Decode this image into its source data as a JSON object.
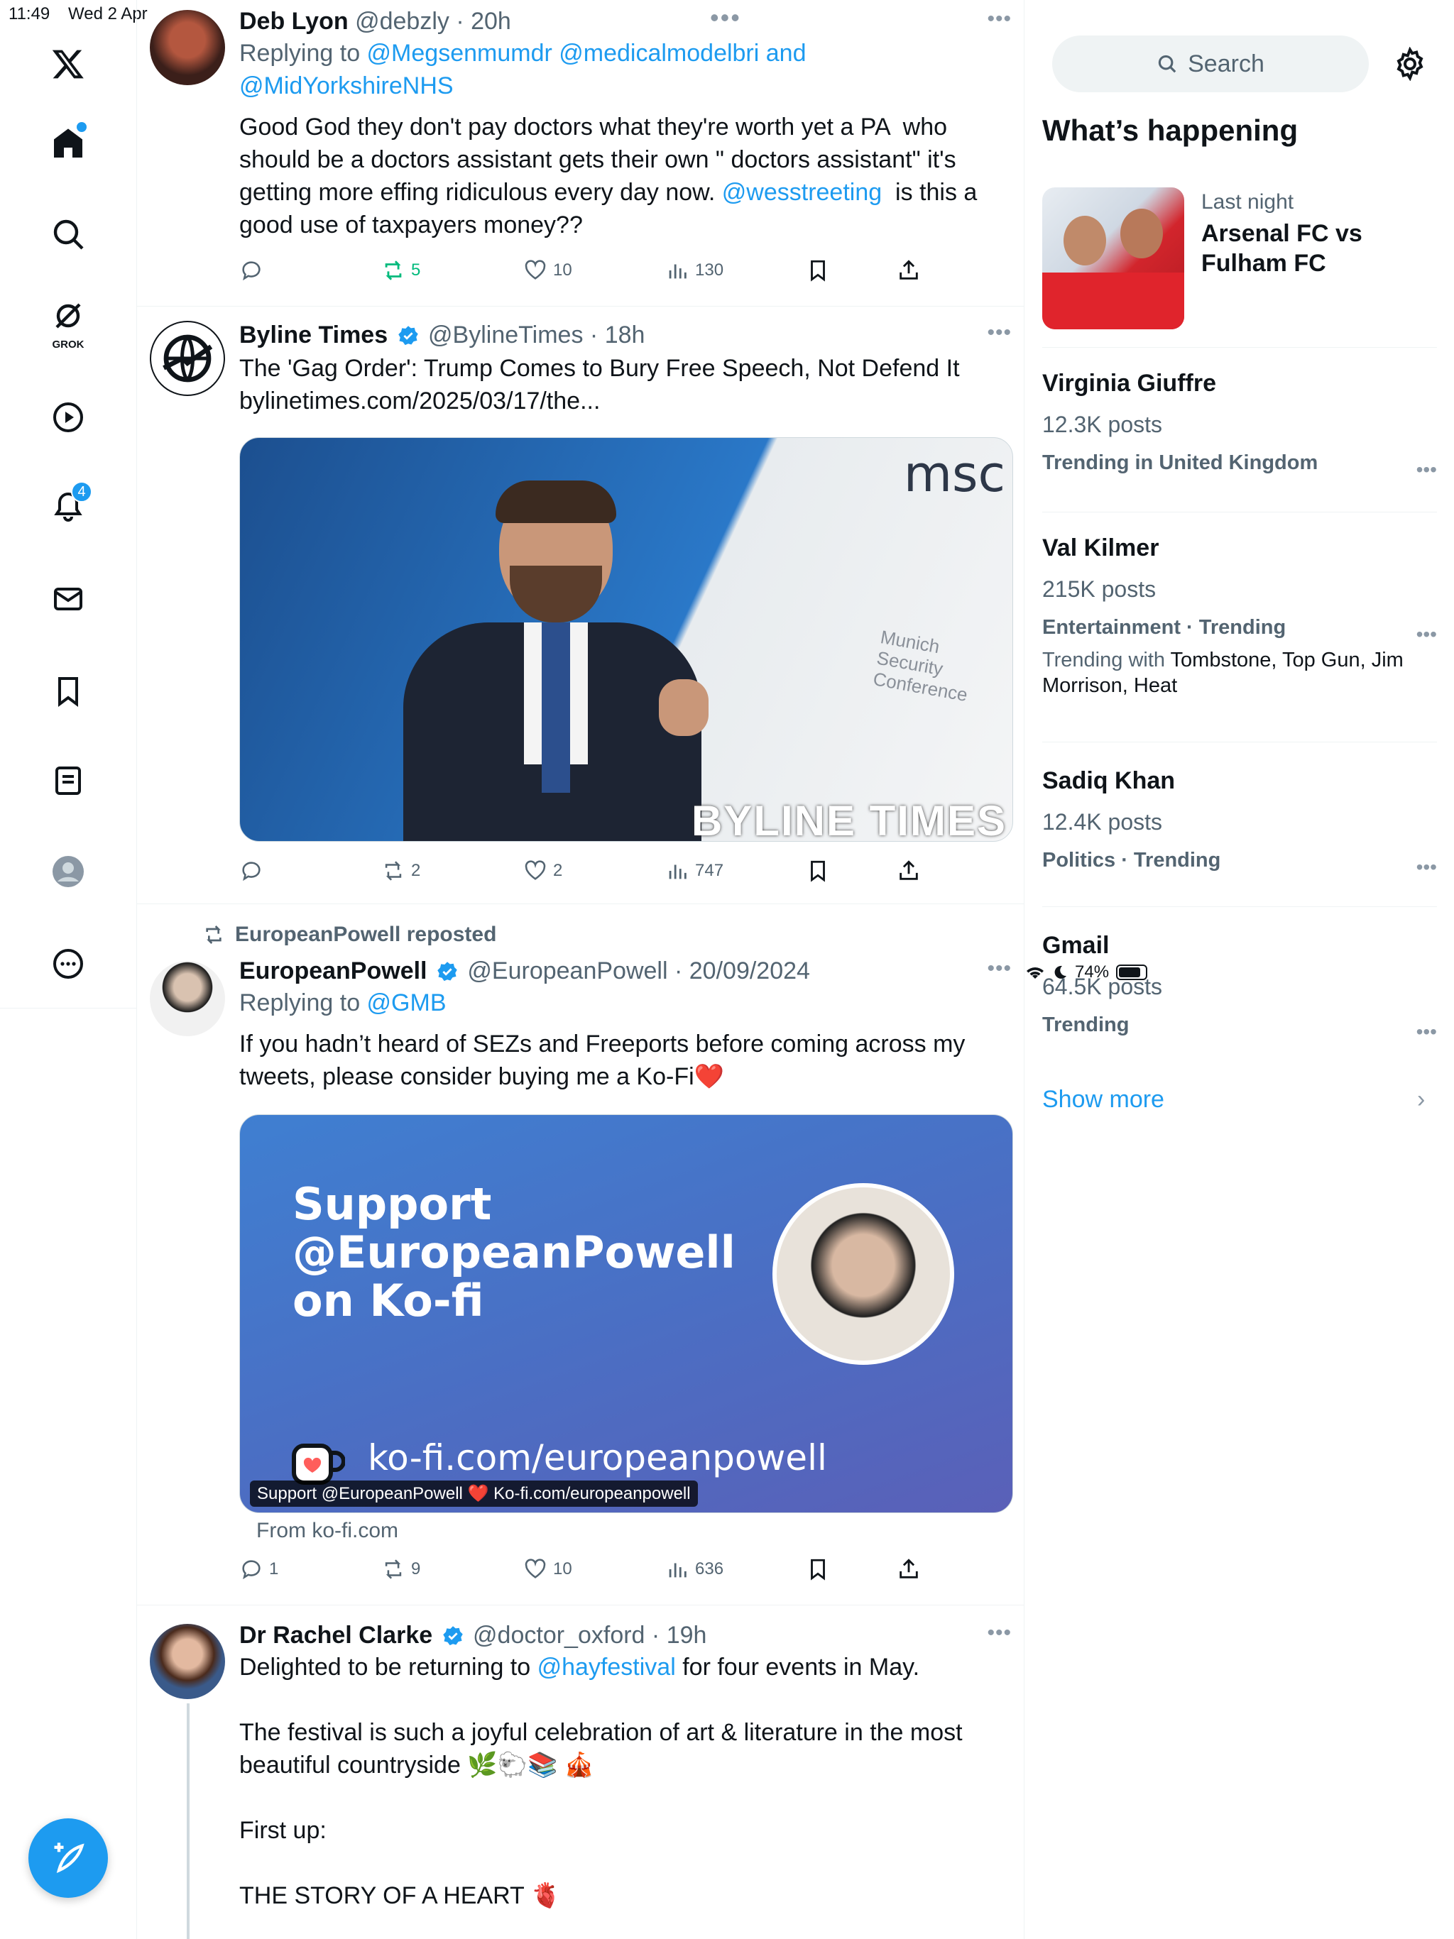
{
  "status_bar": {
    "time": "11:49",
    "date": "Wed 2 Apr",
    "battery": "74%"
  },
  "sidebar": {
    "items": [
      {
        "name": "x-logo"
      },
      {
        "name": "home"
      },
      {
        "name": "explore"
      },
      {
        "name": "grok",
        "label": "GROK"
      },
      {
        "name": "video"
      },
      {
        "name": "notifications",
        "badge": "4"
      },
      {
        "name": "messages"
      },
      {
        "name": "bookmarks"
      },
      {
        "name": "lists"
      },
      {
        "name": "profile"
      },
      {
        "name": "more"
      }
    ]
  },
  "tweets": [
    {
      "name": "Deb Lyon",
      "handle": "@debzly",
      "time": "20h",
      "replying_prefix": "Replying to ",
      "replying_to": "@Megsenmumdr @medicalmodelbri",
      "replying_and": " and",
      "replying_to_2": "@MidYorkshireNHS",
      "text_1": "Good God they don't pay doctors what they're worth yet a PA  who should be a doctors assistant gets their own \" doctors assistant\" it's getting more effing ridiculous every day now. ",
      "mention": "@wesstreeting",
      "text_2": "  is this a good use of taxpayers money??",
      "replies": "",
      "reposts": "5",
      "likes": "10",
      "views": "130"
    },
    {
      "name": "Byline Times",
      "handle": "@BylineTimes",
      "time": "18h",
      "text": "The 'Gag Order': Trump Comes to Bury Free Speech, Not Defend It",
      "link": "bylinetimes.com/2025/03/17/the...",
      "image_watermark": "BYLINE TIMES",
      "image_logo": "msc",
      "image_sign": "Munich Security Conference",
      "replies": "",
      "reposts": "2",
      "likes": "2",
      "views": "747"
    },
    {
      "repost_by": "EuropeanPowell reposted",
      "name": "EuropeanPowell",
      "handle": "@EuropeanPowell",
      "time": "20/09/2024",
      "replying_prefix": "Replying to ",
      "replying_to": "@GMB",
      "text": "If you hadn’t heard of SEZs and Freeports before coming across my tweets, please consider buying me a Ko-Fi❤️",
      "card_title_1": "Support",
      "card_title_2": "@EuropeanPowell",
      "card_title_3": "on Ko-fi",
      "card_url": "ko-fi.com/europeanpowell",
      "card_caption": "Support @EuropeanPowell ❤️ Ko-fi.com/europeanpowell",
      "card_source": "From ko-fi.com",
      "replies": "1",
      "reposts": "9",
      "likes": "10",
      "views": "636"
    },
    {
      "name": "Dr Rachel Clarke",
      "handle": "@doctor_oxford",
      "time": "19h",
      "text_1": "Delighted to be returning to ",
      "mention": "@hayfestival",
      "text_2": " for four events in May.",
      "para_2": "The festival is such a joyful celebration of art & literature in the most beautiful countryside 🌿🐑📚 🎪",
      "para_3": "First up:",
      "para_4": "THE STORY OF A HEART 🫀"
    }
  ],
  "right_panel": {
    "search_placeholder": "Search",
    "heading": "What’s happening",
    "feature": {
      "meta": "Last night",
      "title": "Arsenal FC vs Fulham FC"
    },
    "trends": [
      {
        "name": "Virginia Giuffre",
        "count": "12.3K posts",
        "category": "Trending in United Kingdom"
      },
      {
        "name": "Val Kilmer",
        "count": "215K posts",
        "category": "Entertainment · Trending",
        "with_prefix": "Trending with ",
        "with": "Tombstone, Top Gun, Jim Morrison, Heat"
      },
      {
        "name": "Sadiq Khan",
        "count": "12.4K posts",
        "category": "Politics · Trending"
      },
      {
        "name": "Gmail",
        "count": "64.5K posts",
        "category": "Trending"
      }
    ],
    "show_more": "Show more"
  },
  "colors": {
    "accent": "#1d9bf0",
    "text": "#0f1419",
    "muted": "#536471",
    "repost_green": "#00ba7c"
  }
}
